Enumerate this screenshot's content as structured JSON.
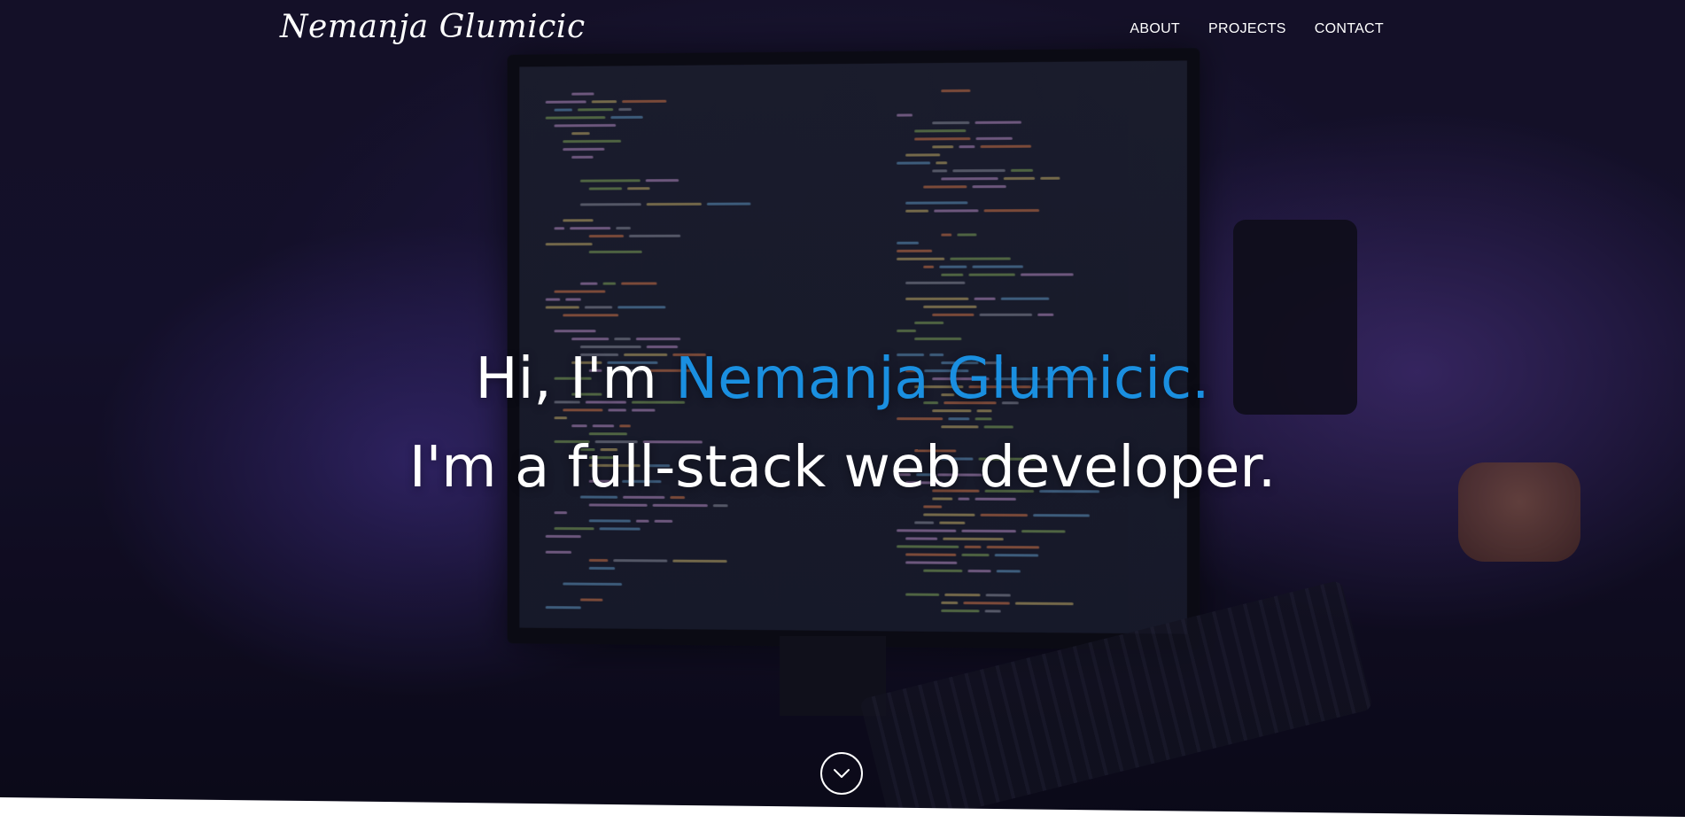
{
  "navbar": {
    "brand": "Nemanja Glumicic",
    "links": [
      {
        "label": "ABOUT"
      },
      {
        "label": "PROJECTS"
      },
      {
        "label": "CONTACT"
      }
    ]
  },
  "hero": {
    "line1_prefix": "Hi, I'm ",
    "line1_name": "Nemanja Glumicic.",
    "line2": "I'm a full-stack web developer.",
    "scroll_icon": "chevron-down-icon"
  },
  "colors": {
    "accent": "#1a8fe0",
    "text": "#ffffff",
    "below_fold_bg": "#ffffff"
  }
}
